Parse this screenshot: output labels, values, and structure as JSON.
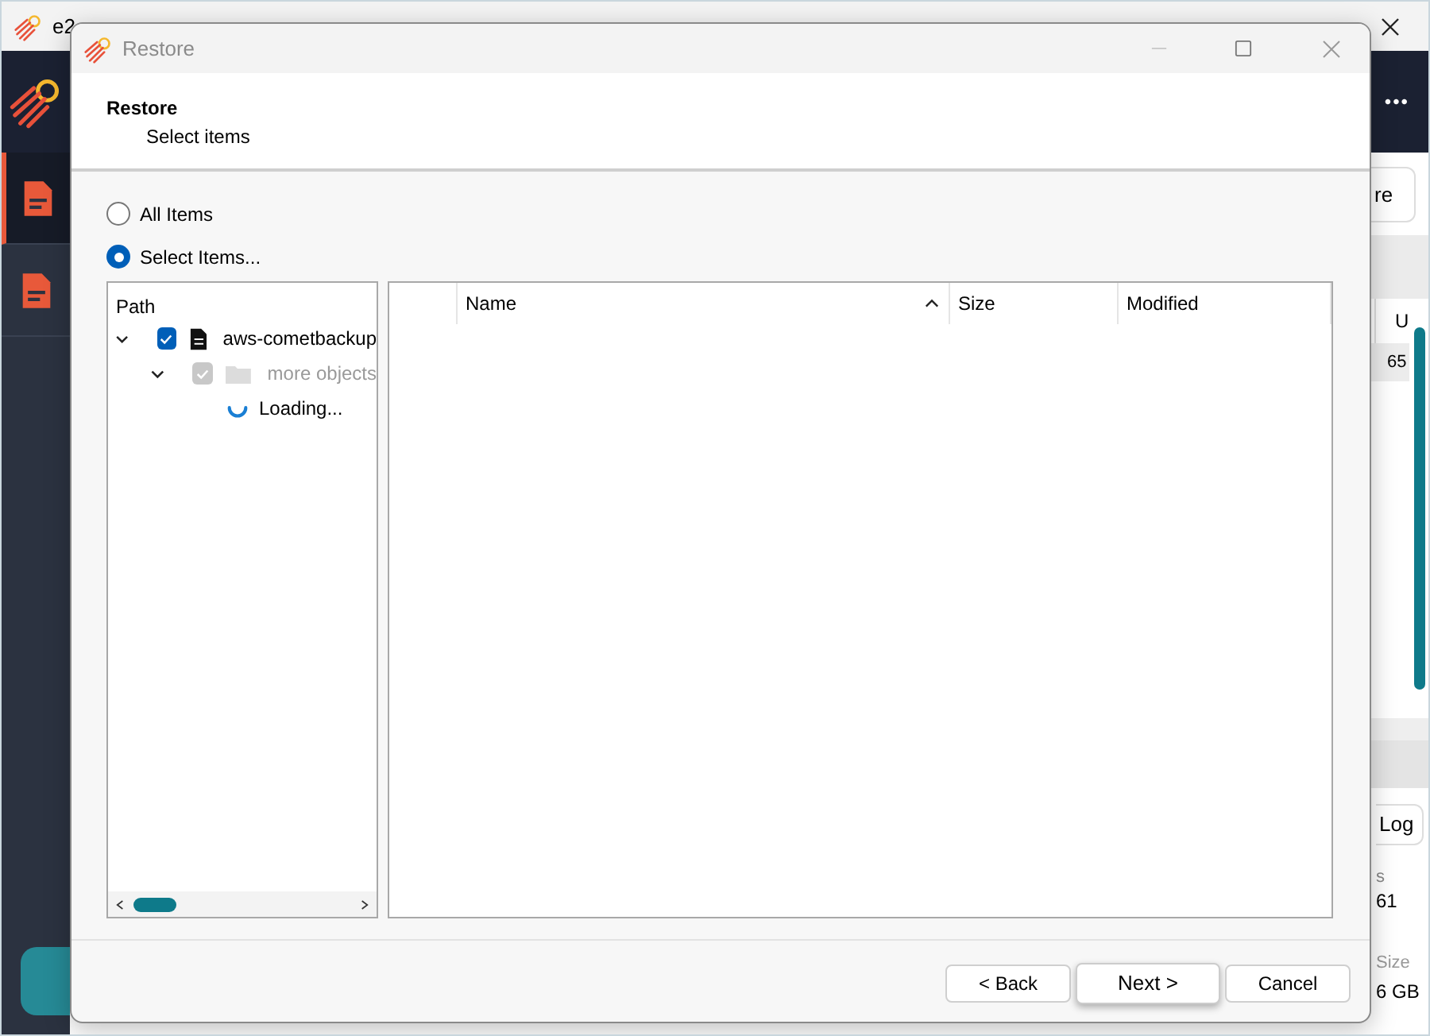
{
  "app": {
    "title": "e2",
    "more_button": "•••",
    "partial_button": "re",
    "column_header": "U",
    "cell": "65",
    "log_button": "Log",
    "stat_label": "s",
    "stat_value": "61",
    "size_label": "Size",
    "size_value": "6 GB",
    "sidebar_items": [
      {
        "selected": true
      },
      {
        "selected": false
      }
    ]
  },
  "dialog": {
    "title": "Restore",
    "heading": "Restore",
    "subheading": "Select items",
    "options": [
      {
        "label": "All Items",
        "selected": false
      },
      {
        "label": "Select Items...",
        "selected": true
      }
    ],
    "tree": {
      "header": "Path",
      "items": [
        {
          "kind": "file",
          "label": "aws-cometbackup",
          "checked": true,
          "disabled": false,
          "expanded": true,
          "children": [
            {
              "kind": "folder",
              "label": "more objects",
              "checked": true,
              "disabled": true,
              "expanded": true,
              "children": [
                {
                  "kind": "loading",
                  "label": "Loading..."
                }
              ]
            }
          ]
        }
      ]
    },
    "columns": [
      {
        "label": "Name",
        "sorted": true
      },
      {
        "label": "Size",
        "sorted": false
      },
      {
        "label": "Modified",
        "sorted": false
      }
    ],
    "buttons": [
      {
        "label": "< Back",
        "default": false
      },
      {
        "label": "Next >",
        "default": true
      },
      {
        "label": "Cancel",
        "default": false
      }
    ]
  }
}
